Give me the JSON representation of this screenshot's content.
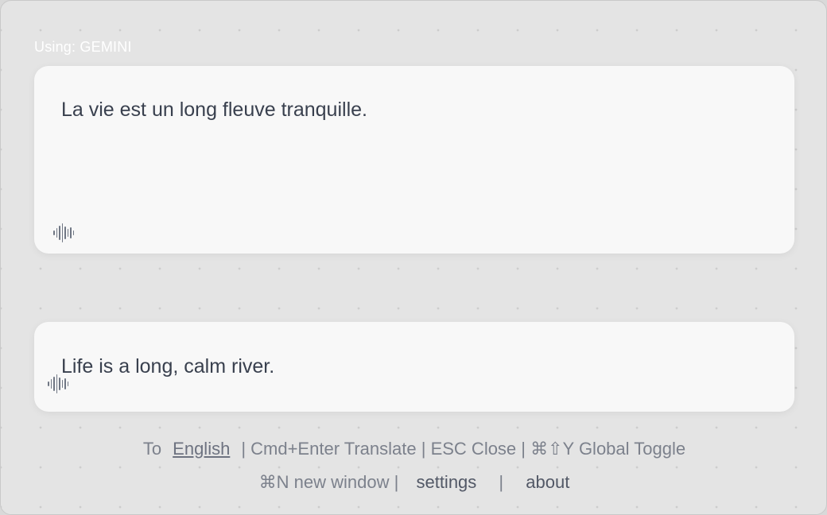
{
  "provider_label": "Using: GEMINI",
  "source": {
    "text": "La vie est un long fleuve tranquille.",
    "speak_icon": "waveform-icon"
  },
  "translation": {
    "text": "Life is a long, calm river.",
    "speak_icon": "waveform-icon"
  },
  "footer": {
    "to_label": "To",
    "target_language": "English",
    "shortcut_translate": "| Cmd+Enter Translate",
    "shortcut_close": "| ESC Close",
    "shortcut_global": "| ⌘⇧Y Global Toggle",
    "new_window": "⌘N new window |",
    "settings_label": "settings",
    "separator": "|",
    "about_label": "about"
  },
  "colors": {
    "text_primary": "#39404e",
    "text_secondary": "#7c818c",
    "card_bg": "#f8f8f8",
    "window_bg": "#e4e4e4"
  }
}
